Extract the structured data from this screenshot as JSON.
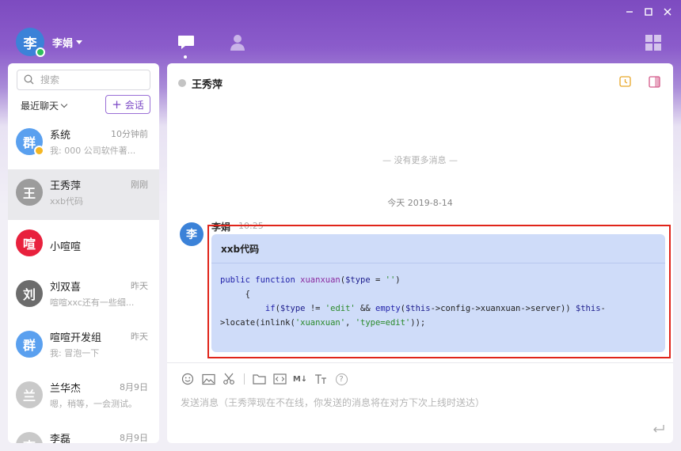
{
  "user": {
    "name": "李娟",
    "avatar_char": "李"
  },
  "sidebar": {
    "search_placeholder": "搜索",
    "filter_label": "最近聊天",
    "new_chat_label": "会话",
    "conversations": [
      {
        "avatar": "群",
        "name": "系统",
        "time": "10分钟前",
        "preview": "我: 000 公司软件著...",
        "color": "#5aa0ef",
        "badge": true
      },
      {
        "avatar": "王",
        "name": "王秀萍",
        "time": "刚刚",
        "preview": "xxb代码",
        "color": "#9c9c9c",
        "active": true
      },
      {
        "avatar": "喧",
        "name": "小喧喧",
        "time": "",
        "preview": "",
        "color": "#e8213d"
      },
      {
        "avatar": "刘",
        "name": "刘双喜",
        "time": "昨天",
        "preview": "喧喧xxc还有一些细...",
        "color": "#6c6c6c"
      },
      {
        "avatar": "群",
        "name": "喧喧开发组",
        "time": "昨天",
        "preview": "我: 冒泡一下",
        "color": "#5aa0ef"
      },
      {
        "avatar": "兰",
        "name": "兰华杰",
        "time": "8月9日",
        "preview": "嗯，稍等，一会测试。",
        "color": "#c9c9c9"
      },
      {
        "avatar": "李",
        "name": "李磊",
        "time": "8月9日",
        "preview": "",
        "color": "#c9c9c9"
      }
    ]
  },
  "chat": {
    "title": "王秀萍",
    "no_more": "— 没有更多消息 —",
    "date_separator": "今天 2019-8-14",
    "message": {
      "avatar": "李",
      "sender": "李娟",
      "time": "10:25",
      "code_title": "xxb代码"
    },
    "input_placeholder": "发送消息（王秀萍现在不在线，你发送的消息将在对方下次上线时送达）",
    "md_label": "M↓",
    "help_label": "?"
  }
}
